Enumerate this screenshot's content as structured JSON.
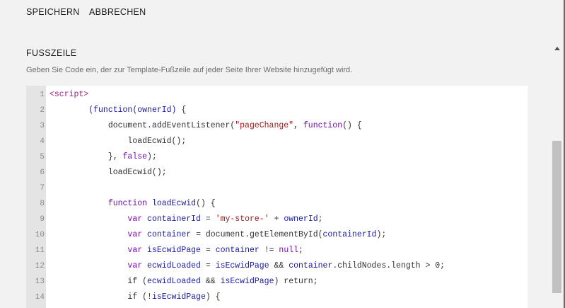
{
  "toolbar": {
    "save_label": "SPEICHERN",
    "cancel_label": "ABBRECHEN"
  },
  "section": {
    "title": "FUSSZEILE",
    "description": "Geben Sie Code ein, der zur Template-Fußzeile auf jeder Seite Ihrer Website hinzugefügt wird."
  },
  "editor": {
    "lines": [
      {
        "number": "1",
        "tokens": [
          [
            "tag",
            "<script>"
          ]
        ]
      },
      {
        "number": "2",
        "tokens": [
          [
            "plain",
            "        "
          ],
          [
            "var",
            "(function("
          ],
          [
            "var",
            "ownerId"
          ],
          [
            "var",
            ")"
          ],
          [
            "plain",
            " {"
          ]
        ]
      },
      {
        "number": "3",
        "tokens": [
          [
            "plain",
            "            document.addEventListener("
          ],
          [
            "str",
            "\"pageChange\""
          ],
          [
            "plain",
            ", "
          ],
          [
            "kw",
            "function"
          ],
          [
            "plain",
            "() {"
          ]
        ]
      },
      {
        "number": "4",
        "tokens": [
          [
            "plain",
            "                loadEcwid();"
          ]
        ]
      },
      {
        "number": "5",
        "tokens": [
          [
            "plain",
            "            }, "
          ],
          [
            "kw",
            "false"
          ],
          [
            "plain",
            ");"
          ]
        ]
      },
      {
        "number": "6",
        "tokens": [
          [
            "plain",
            "            loadEcwid();"
          ]
        ]
      },
      {
        "number": "7",
        "tokens": [
          [
            "plain",
            ""
          ]
        ]
      },
      {
        "number": "8",
        "tokens": [
          [
            "plain",
            "            "
          ],
          [
            "kw",
            "function"
          ],
          [
            "plain",
            " "
          ],
          [
            "var",
            "loadEcwid"
          ],
          [
            "plain",
            "() {"
          ]
        ]
      },
      {
        "number": "9",
        "tokens": [
          [
            "plain",
            "                "
          ],
          [
            "kw",
            "var"
          ],
          [
            "plain",
            " "
          ],
          [
            "var",
            "containerId"
          ],
          [
            "plain",
            " = "
          ],
          [
            "str",
            "'my-store-'"
          ],
          [
            "plain",
            " + "
          ],
          [
            "var",
            "ownerId"
          ],
          [
            "plain",
            ";"
          ]
        ]
      },
      {
        "number": "10",
        "tokens": [
          [
            "plain",
            "                "
          ],
          [
            "kw",
            "var"
          ],
          [
            "plain",
            " "
          ],
          [
            "var",
            "container"
          ],
          [
            "plain",
            " = document.getElementById("
          ],
          [
            "var",
            "containerId"
          ],
          [
            "plain",
            ");"
          ]
        ]
      },
      {
        "number": "11",
        "tokens": [
          [
            "plain",
            "                "
          ],
          [
            "kw",
            "var"
          ],
          [
            "plain",
            " "
          ],
          [
            "var",
            "isEcwidPage"
          ],
          [
            "plain",
            " = "
          ],
          [
            "var",
            "container"
          ],
          [
            "plain",
            " != "
          ],
          [
            "kw",
            "null"
          ],
          [
            "plain",
            ";"
          ]
        ]
      },
      {
        "number": "12",
        "tokens": [
          [
            "plain",
            "                "
          ],
          [
            "kw",
            "var"
          ],
          [
            "plain",
            " "
          ],
          [
            "var",
            "ecwidLoaded"
          ],
          [
            "plain",
            " = "
          ],
          [
            "var",
            "isEcwidPage"
          ],
          [
            "plain",
            " && "
          ],
          [
            "var",
            "container"
          ],
          [
            "plain",
            ".childNodes.length > 0;"
          ]
        ]
      },
      {
        "number": "13",
        "tokens": [
          [
            "plain",
            "                if ("
          ],
          [
            "var",
            "ecwidLoaded"
          ],
          [
            "plain",
            " && "
          ],
          [
            "var",
            "isEcwidPage"
          ],
          [
            "plain",
            ") return;"
          ]
        ]
      },
      {
        "number": "14",
        "tokens": [
          [
            "plain",
            "                if (!"
          ],
          [
            "var",
            "isEcwidPage"
          ],
          [
            "plain",
            ") {"
          ]
        ]
      }
    ]
  },
  "colors": {
    "background": "#f2f2f2",
    "gutter": "#e4e4e4",
    "tag": "#a31f8c",
    "keyword": "#7a0fb0",
    "variable": "#1a1aa6",
    "string": "#a11a1a"
  },
  "icons": {
    "scroll_up": "caret-up-icon"
  }
}
